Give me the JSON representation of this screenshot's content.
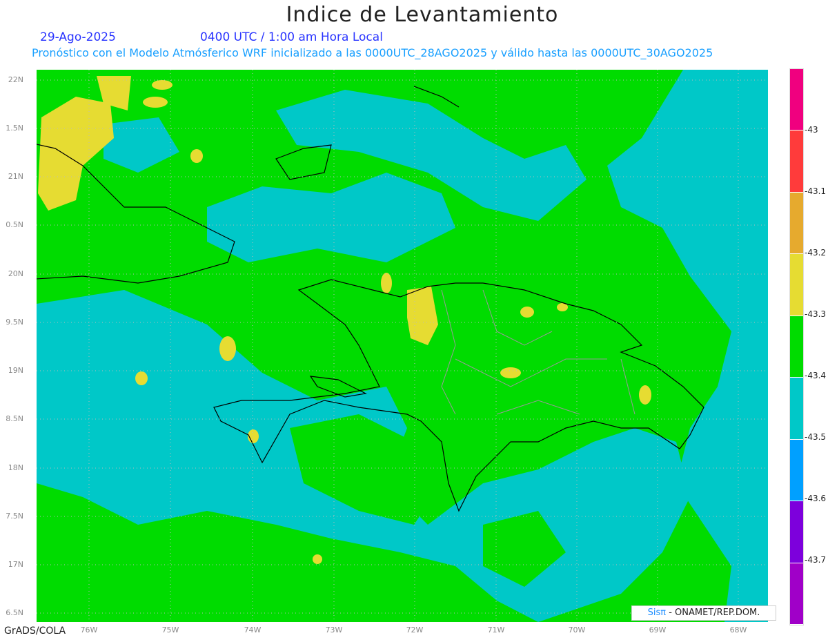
{
  "header": {
    "title": "Indice de Levantamiento",
    "date": "29-Ago-2025",
    "time": "0400 UTC / 1:00 am Hora Local",
    "subtitle": "Pronóstico con el Modelo Atmósferico WRF inicializado a las 0000UTC_28AGO2025 y válido hasta las  0000UTC_30AGO2025"
  },
  "axes": {
    "y_labels": [
      "22N",
      "1.5N",
      "21N",
      "0.5N",
      "20N",
      "9.5N",
      "19N",
      "8.5N",
      "18N",
      "7.5N",
      "17N",
      "6.5N"
    ],
    "x_labels": [
      "76W",
      "75W",
      "74W",
      "73W",
      "72W",
      "71W",
      "70W",
      "69W",
      "68W"
    ]
  },
  "colorbar": {
    "labels": [
      "-43",
      "-43.1",
      "-43.2",
      "-43.3",
      "-43.4",
      "-43.5",
      "-43.6",
      "-43.7"
    ],
    "colors": [
      "#f0007f",
      "#ff3b3b",
      "#e6aa2e",
      "#e6dc32",
      "#00dc00",
      "#00c8c8",
      "#00a0ff",
      "#7d00dc",
      "#a000c8"
    ]
  },
  "footer": {
    "software": "GrADS/COLA",
    "credit_brand": "Sisπ",
    "credit_text": " - ONAMET/REP.DOM."
  }
}
